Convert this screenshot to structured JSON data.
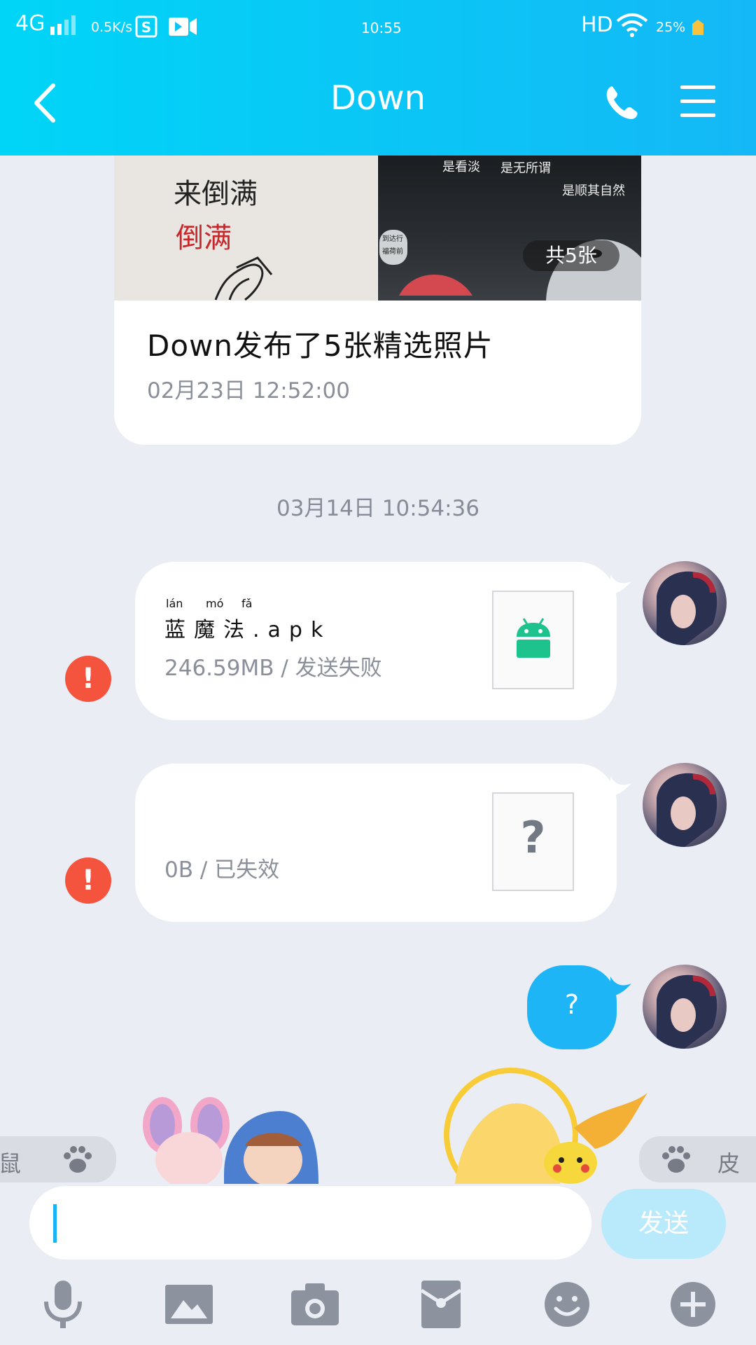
{
  "status_bar": {
    "network": "4G",
    "speed": "0.5K/s",
    "time": "10:55",
    "hd": "HD",
    "battery": "25%"
  },
  "header": {
    "title": "Down"
  },
  "photo_card": {
    "left_text": [
      "来倒满",
      "倒满"
    ],
    "right_text": [
      "是看淡",
      "是无所谓",
      "是顺其自然"
    ],
    "sign_text": [
      "到达行",
      "福荷前"
    ],
    "count_badge": "共5张",
    "title": "Down发布了5张精选照片",
    "date": "02月23日 12:52:00"
  },
  "timestamp": "03月14日 10:54:36",
  "messages": [
    {
      "file_name": "蓝魔法.apk",
      "pinyin": [
        "lán",
        "mó",
        "fǎ"
      ],
      "meta": "246.59MB / 发送失败",
      "error": "!"
    },
    {
      "file_name": "",
      "meta": "0B / 已失效",
      "placeholder": "?",
      "error": "!"
    }
  ],
  "blue_message": "?",
  "sticker_pills": {
    "left": "鼠",
    "right": "皮"
  },
  "input": {
    "send_label": "发送"
  },
  "colors": {
    "header_start": "#00D5F7",
    "header_end": "#14B8F6",
    "error": "#F4533D",
    "android_green": "#1EC28C",
    "accent": "#1EB5F7"
  }
}
